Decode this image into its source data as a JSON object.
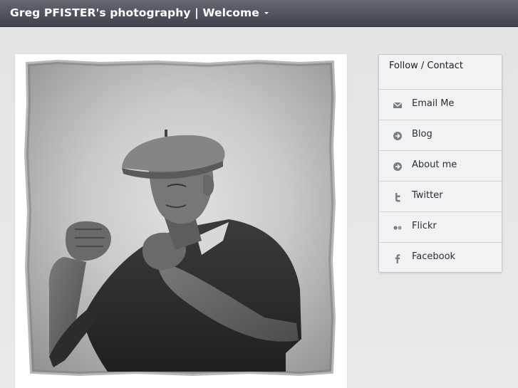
{
  "header": {
    "title": "Greg PFISTER's photography | Welcome",
    "dropdown_icon": "caret-down-icon"
  },
  "photo": {
    "description_icon": "portrait-photo"
  },
  "contact": {
    "heading": "Follow / Contact",
    "items": [
      {
        "label": "Email Me",
        "icon": "envelope-icon"
      },
      {
        "label": "Blog",
        "icon": "arrow-circle-icon"
      },
      {
        "label": "About me",
        "icon": "arrow-circle-icon"
      },
      {
        "label": "Twitter",
        "icon": "twitter-icon"
      },
      {
        "label": "Flickr",
        "icon": "flickr-icon"
      },
      {
        "label": "Facebook",
        "icon": "facebook-icon"
      }
    ]
  },
  "colors": {
    "topbar": "#4f535a",
    "background": "#e6e7e9",
    "icon": "#7b7f85"
  }
}
